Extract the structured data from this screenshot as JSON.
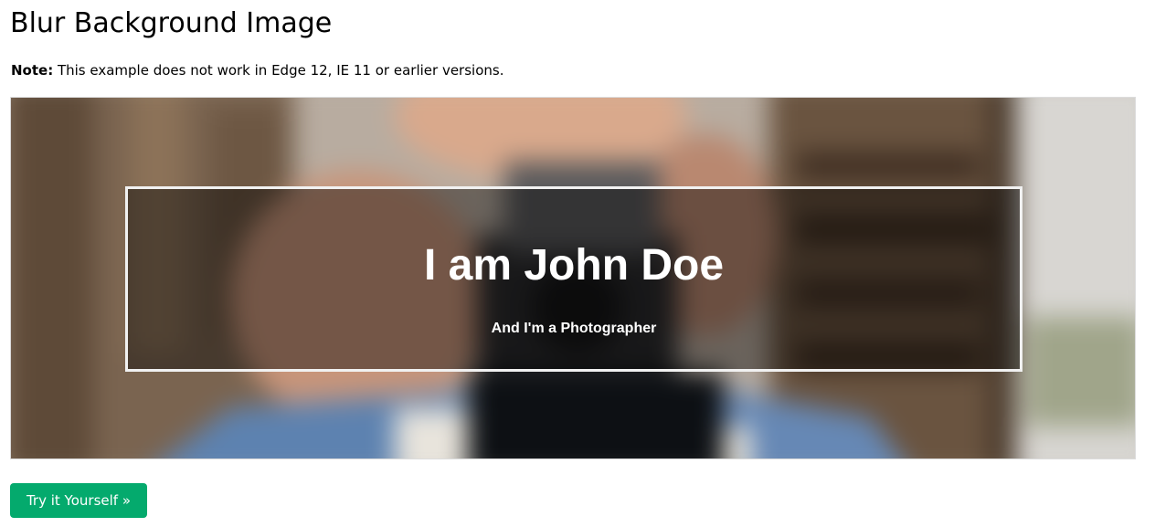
{
  "page": {
    "title": "Blur Background Image",
    "note_label": "Note:",
    "note_text": " This example does not work in Edge 12, IE 11 or earlier versions."
  },
  "example": {
    "image_description_icon": "photographer-photo-image",
    "hero_title": "I am John Doe",
    "hero_subtitle": "And I'm a Photographer"
  },
  "actions": {
    "try_button_label": "Try it Yourself »"
  },
  "colors": {
    "button_green": "#04aa6d",
    "overlay": "rgba(0,0,0,0.42)",
    "overlay_border": "#f1f1f1"
  }
}
